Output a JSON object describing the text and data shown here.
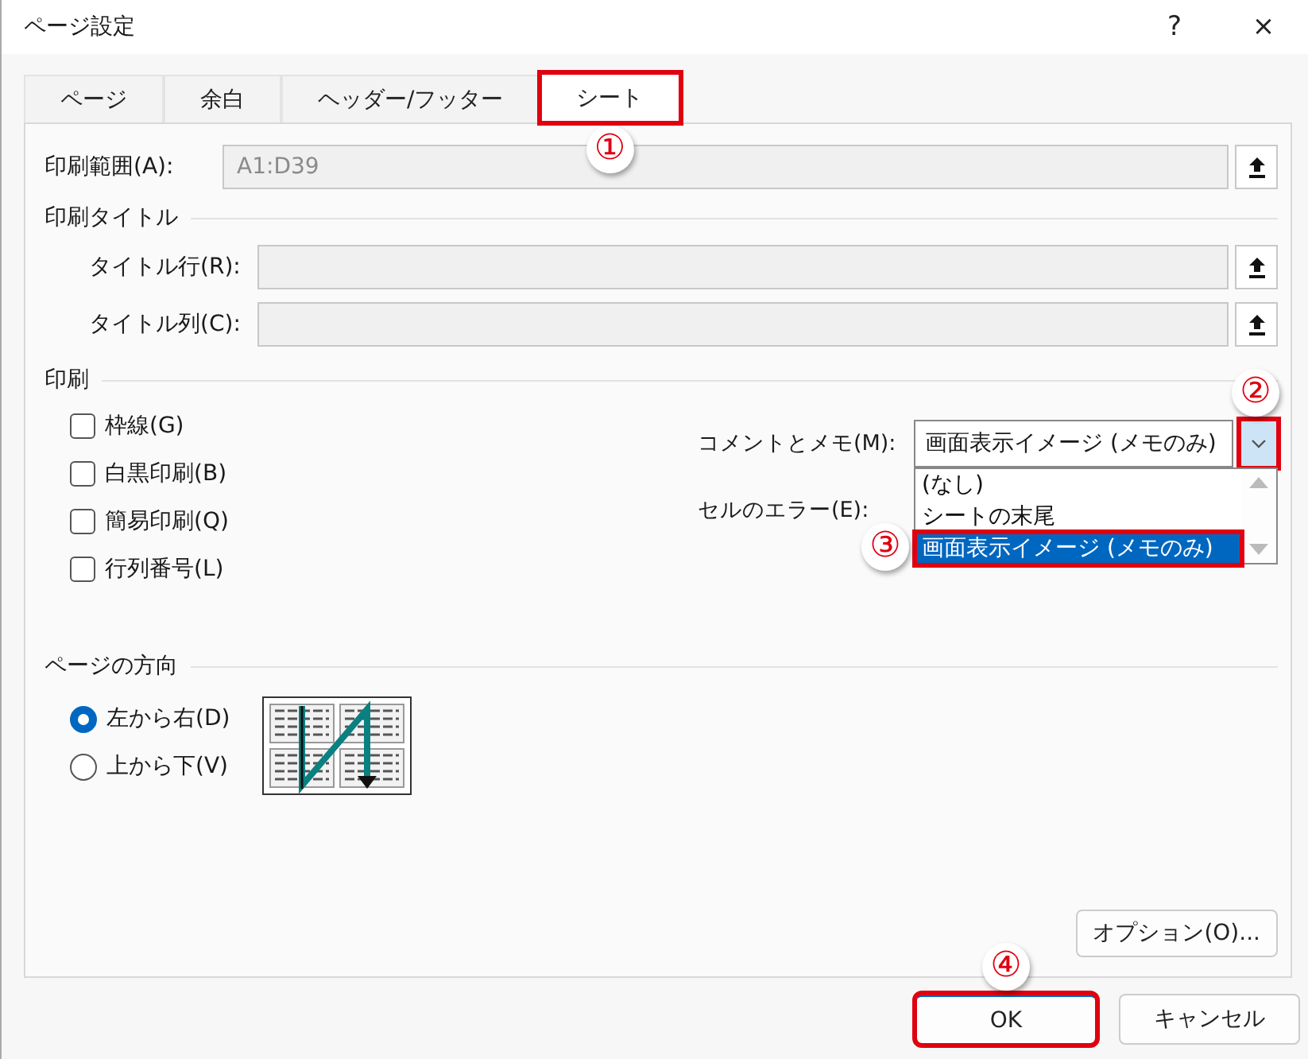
{
  "window": {
    "title": "ページ設定",
    "help_button": "?",
    "close_button": "×"
  },
  "tabs": [
    {
      "label": "ページ",
      "selected": false
    },
    {
      "label": "余白",
      "selected": false
    },
    {
      "label": "ヘッダー/フッター",
      "selected": false
    },
    {
      "label": "シート",
      "selected": true,
      "highlighted": true,
      "callout": "①"
    }
  ],
  "print_area": {
    "label": "印刷範囲(A):",
    "value": "A1:D39"
  },
  "print_titles": {
    "heading": "印刷タイトル",
    "fields": [
      {
        "label": "タイトル行(R):"
      },
      {
        "label": "タイトル列(C):"
      }
    ]
  },
  "print": {
    "heading": "印刷",
    "options": [
      {
        "label": "枠線(G)",
        "checked": false
      },
      {
        "label": "白黒印刷(B)",
        "checked": false
      },
      {
        "label": "簡易印刷(Q)",
        "checked": false
      },
      {
        "label": "行列番号(L)",
        "checked": false
      }
    ],
    "comments": {
      "label": "コメントとメモ(M):",
      "value": "画面表示イメージ (メモのみ)",
      "expanded": true,
      "dropdown_highlighted": true,
      "dropdown_callout": "②",
      "options": [
        {
          "label": "(なし)",
          "selected": false
        },
        {
          "label": "シートの末尾",
          "selected": false
        },
        {
          "label": "画面表示イメージ (メモのみ)",
          "selected": true,
          "highlighted": true,
          "callout": "③"
        }
      ]
    },
    "cell_errors": {
      "label": "セルのエラー(E):"
    }
  },
  "page_order": {
    "heading": "ページの方向",
    "options": [
      {
        "label": "左から右(D)",
        "selected": true
      },
      {
        "label": "上から下(V)",
        "selected": false
      }
    ]
  },
  "options_button": {
    "label": "オプション(O)..."
  },
  "buttons": [
    {
      "label": "OK",
      "default": true,
      "highlighted": true,
      "callout": "④"
    },
    {
      "label": "キャンセル",
      "default": false
    }
  ]
}
